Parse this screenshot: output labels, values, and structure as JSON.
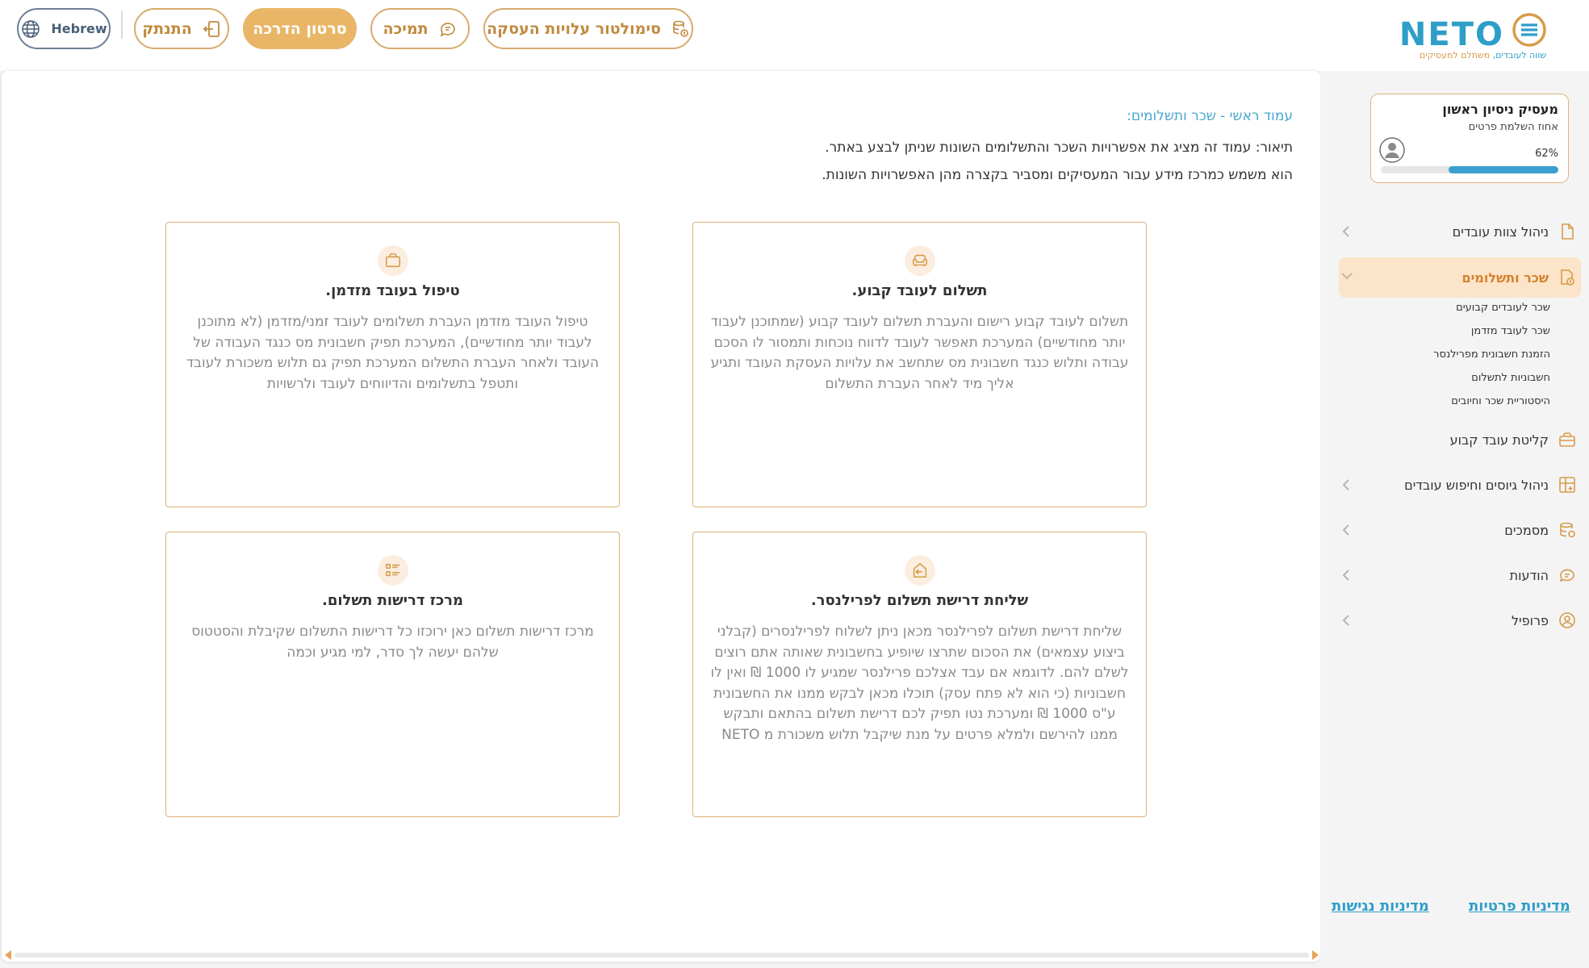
{
  "header": {
    "simulator_label": "סימולטור עלויות העסקה",
    "support_label": "תמיכה",
    "guide_label": "סרטון הדרכה",
    "logout_label": "התנתק",
    "language_label": "Hebrew",
    "logo": {
      "word": "NETO",
      "tagline_a": "שווה לעובדים,",
      "tagline_b": "משתלם למעסיקים"
    }
  },
  "main": {
    "breadcrumb": "עמוד ראשי - שכר ותשלומים:",
    "description_1": "תיאור: עמוד זה מציג את אפשרויות השכר והתשלומים השונות שניתן לבצע באתר.",
    "description_2": "הוא משמש כמרכז מידע עבור המעסיקים ומסביר בקצרה מהן האפשרויות השונות.",
    "cards": [
      {
        "icon": "sofa-icon",
        "title": "תשלום לעובד קבוע.",
        "text": "תשלום לעובד קבוע רישום והעברת תשלום לעובד קבוע (שמתוכנן לעבוד יותר מחודשיים) המערכת תאפשר לעובד לדווח נוכחות ותמסור לו הסכם עבודה ותלוש כנגד חשבונית מס שתחשב את עלויות העסקת העובד ותגיע אליך מיד לאחר העברת התשלום"
      },
      {
        "icon": "briefcase-icon",
        "title": "טיפול בעובד מזדמן.",
        "text": "טיפול העובד מזדמן העברת תשלומים לעובד זמני/מזדמן (לא מתוכנן לעבוד יותר מחודשיים), המערכת תפיק חשבונית מס כנגד העבודה של העובד ולאחר העברת התשלום המערכת תפיק גם תלוש משכורת לעובד ותטפל בתשלומים והדיווחים לעובד ולרשויות"
      },
      {
        "icon": "send-request-icon",
        "title": "שליחת דרישת תשלום לפרילנסר.",
        "text": "שליחת דרישת תשלום לפרילנסר מכאן ניתן לשלוח לפרילנסרים (קבלני ביצוע עצמאים) את הסכום שתרצו שיופיע בחשבונית שאותה אתם רוצים לשלם להם. לדוגמא אם עבד אצלכם פרילנסר שמגיע לו 1000 ₪ ואין לו חשבוניות (כי הוא לא פתח עסק) תוכלו מכאן לבקש ממנו את החשבונית ע\"ס 1000 ₪ ומערכת נטו תפיק לכם דרישת תשלום בהתאם ותבקש ממנו להירשם ולמלא פרטים על מנת שיקבל תלוש משכורת מ NETO"
      },
      {
        "icon": "list-icon",
        "title": "מרכז דרישות תשלום.",
        "text": "מרכז דרישות תשלום כאן ירוכזו כל דרישות התשלום שקיבלת והסטטוס שלהם יעשה לך סדר, למי מגיע וכמה"
      }
    ]
  },
  "sidebar": {
    "profile": {
      "name": "מעסיק ניסיון ראשון",
      "subtitle": "אחוז השלמת פרטים",
      "percent_label": "62%",
      "percent": 62
    },
    "items": [
      {
        "label": "ניהול צוות עובדים",
        "icon": "document-icon"
      },
      {
        "label": "שכר ותשלומים",
        "icon": "payroll-icon"
      },
      {
        "label": "קליטת עובד קבוע",
        "icon": "briefcase-icon"
      },
      {
        "label": "ניהול גיוסים וחיפוש עובדים",
        "icon": "grid-plus-icon"
      },
      {
        "label": "מסמכים",
        "icon": "files-icon"
      },
      {
        "label": "הודעות",
        "icon": "chat-icon"
      },
      {
        "label": "פרופיל",
        "icon": "user-icon"
      }
    ],
    "subitems": [
      "שכר לעובדים קבועים",
      "שכר לעובד מזדמן",
      "הזמנת חשבונית מפרילנסר",
      "חשבוניות לתשלום",
      "היסטוריית שכר וחיובים"
    ],
    "footer": {
      "privacy": "מדיניות פרטיות",
      "accessibility": "מדיניות נגישות"
    }
  },
  "colors": {
    "accent": "#e9b668",
    "accent_dark": "#d3822d",
    "brand_blue": "#2e9ec9",
    "card_border": "#e0b27c"
  }
}
